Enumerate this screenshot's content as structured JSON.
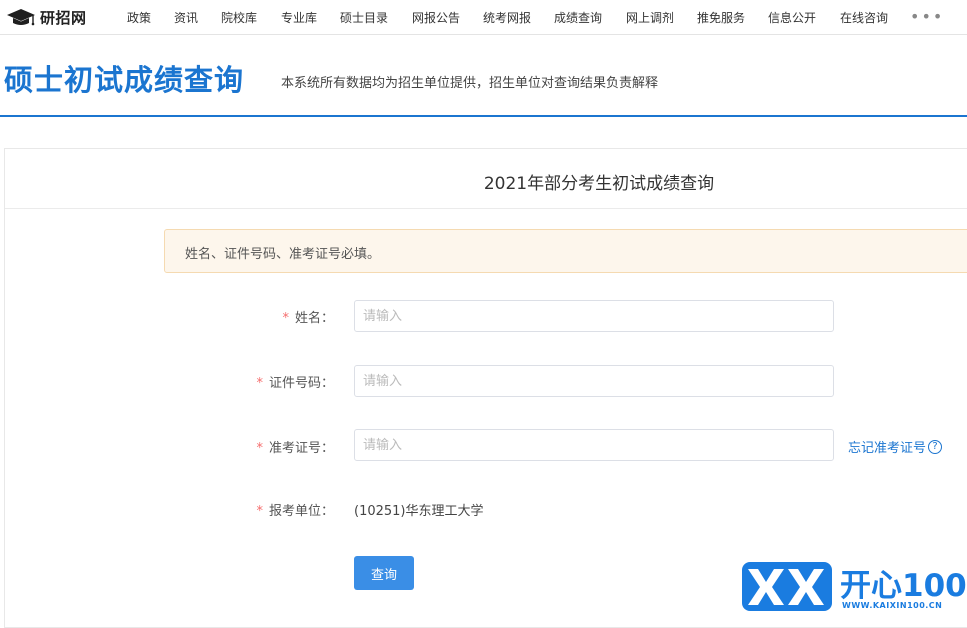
{
  "brand": {
    "name": "研招网"
  },
  "nav": {
    "items": [
      "政策",
      "资讯",
      "院校库",
      "专业库",
      "硕士目录",
      "网报公告",
      "统考网报",
      "成绩查询",
      "网上调剂",
      "推免服务",
      "信息公开",
      "在线咨询"
    ],
    "more": "•••"
  },
  "header": {
    "title": "硕士初试成绩查询",
    "subtitle": "本系统所有数据均为招生单位提供，招生单位对查询结果负责解释"
  },
  "panel": {
    "title": "2021年部分考生初试成绩查询",
    "notice": "姓名、证件号码、准考证号必填。"
  },
  "form": {
    "required_mark": "*",
    "name_label": "姓名：",
    "name_placeholder": "请输入",
    "id_label": "证件号码：",
    "id_placeholder": "请输入",
    "exam_label": "准考证号：",
    "exam_placeholder": "请输入",
    "forgot_link": "忘记准考证号",
    "help_icon": "?",
    "unit_label": "报考单位：",
    "unit_value": "(10251)华东理工大学",
    "submit_label": "查询"
  },
  "watermark": {
    "text": "开心100",
    "url": "WWW.KAIXIN100.CN",
    "color": "#1a7ce0"
  },
  "colors": {
    "accent": "#1b75d0",
    "button": "#3a8ee6",
    "required": "#f56c6c",
    "alert_bg": "#fdf6ec"
  }
}
